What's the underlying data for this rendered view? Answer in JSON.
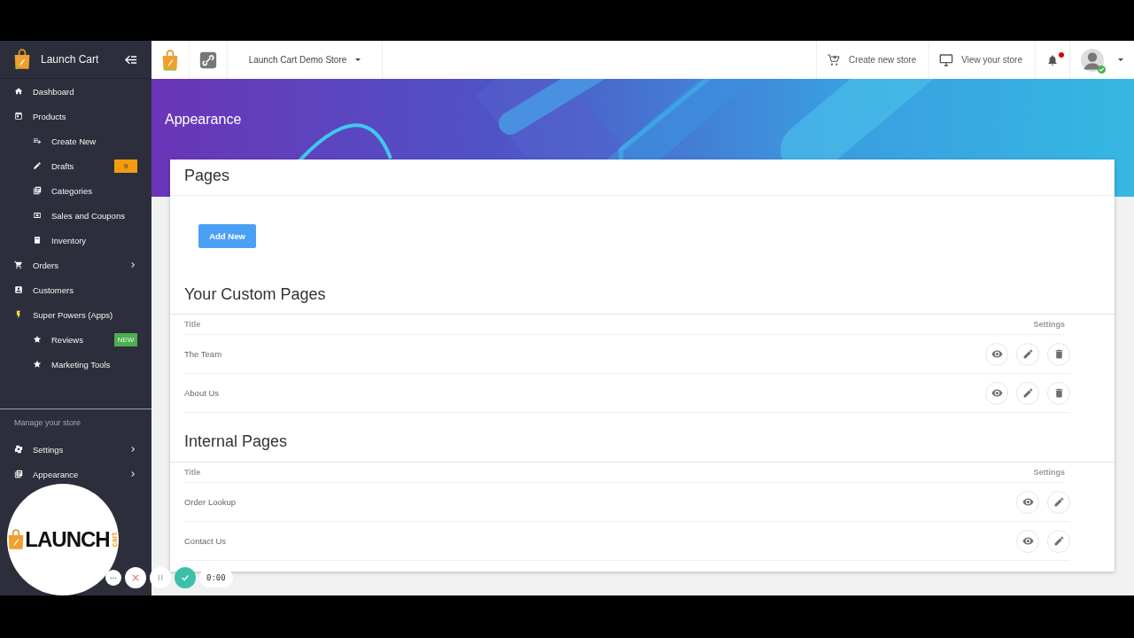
{
  "sidebar": {
    "brand": "Launch Cart",
    "items": [
      {
        "label": "Dashboard",
        "kind": "main",
        "chevron": false
      },
      {
        "label": "Products",
        "kind": "main",
        "chevron": false
      },
      {
        "label": "Create New",
        "kind": "sub",
        "chevron": false
      },
      {
        "label": "Drafts",
        "kind": "sub",
        "chevron": false,
        "badge": {
          "text": "9",
          "color": "#f39c12"
        }
      },
      {
        "label": "Categories",
        "kind": "sub",
        "chevron": false
      },
      {
        "label": "Sales and Coupons",
        "kind": "sub",
        "chevron": false
      },
      {
        "label": "Inventory",
        "kind": "sub",
        "chevron": false
      },
      {
        "label": "Orders",
        "kind": "main",
        "chevron": true
      },
      {
        "label": "Customers",
        "kind": "main",
        "chevron": false
      },
      {
        "label": "Super Powers (Apps)",
        "kind": "main",
        "chevron": false
      },
      {
        "label": "Reviews",
        "kind": "sub",
        "chevron": false,
        "badge": {
          "text": "NEW",
          "color": "#4caf50"
        }
      },
      {
        "label": "Marketing Tools",
        "kind": "sub",
        "chevron": false
      }
    ],
    "section_label": "Manage your store",
    "bottom_items": [
      {
        "label": "Settings",
        "chevron": true
      },
      {
        "label": "Appearance",
        "chevron": true
      }
    ]
  },
  "topbar": {
    "store": "Launch Cart Demo Store",
    "actions": [
      "Create new store",
      "View your store"
    ],
    "notifications_unread": true,
    "user_online": true
  },
  "page_title": "Appearance",
  "card": {
    "title": "Pages",
    "add_button": "Add New",
    "sections": [
      {
        "heading": "Your Custom Pages",
        "columns": [
          "Title",
          "Settings"
        ],
        "rows": [
          {
            "title": "The Team",
            "actions": [
              {
                "kind": "view"
              },
              {
                "kind": "edit"
              },
              {
                "kind": "delete"
              }
            ]
          },
          {
            "title": "About Us",
            "actions": [
              {
                "kind": "view"
              },
              {
                "kind": "edit"
              },
              {
                "kind": "delete"
              }
            ]
          }
        ]
      },
      {
        "heading": "Internal Pages",
        "columns": [
          "Title",
          "Settings"
        ],
        "rows": [
          {
            "title": "Order Lookup",
            "actions": [
              {
                "kind": "view"
              },
              {
                "kind": "edit"
              }
            ]
          },
          {
            "title": "Contact Us",
            "actions": [
              {
                "kind": "view"
              },
              {
                "kind": "edit"
              }
            ]
          }
        ]
      }
    ]
  },
  "recorder": {
    "logo_word": "LAUNCH",
    "logo_sub": "cart",
    "timer": "0:00"
  }
}
